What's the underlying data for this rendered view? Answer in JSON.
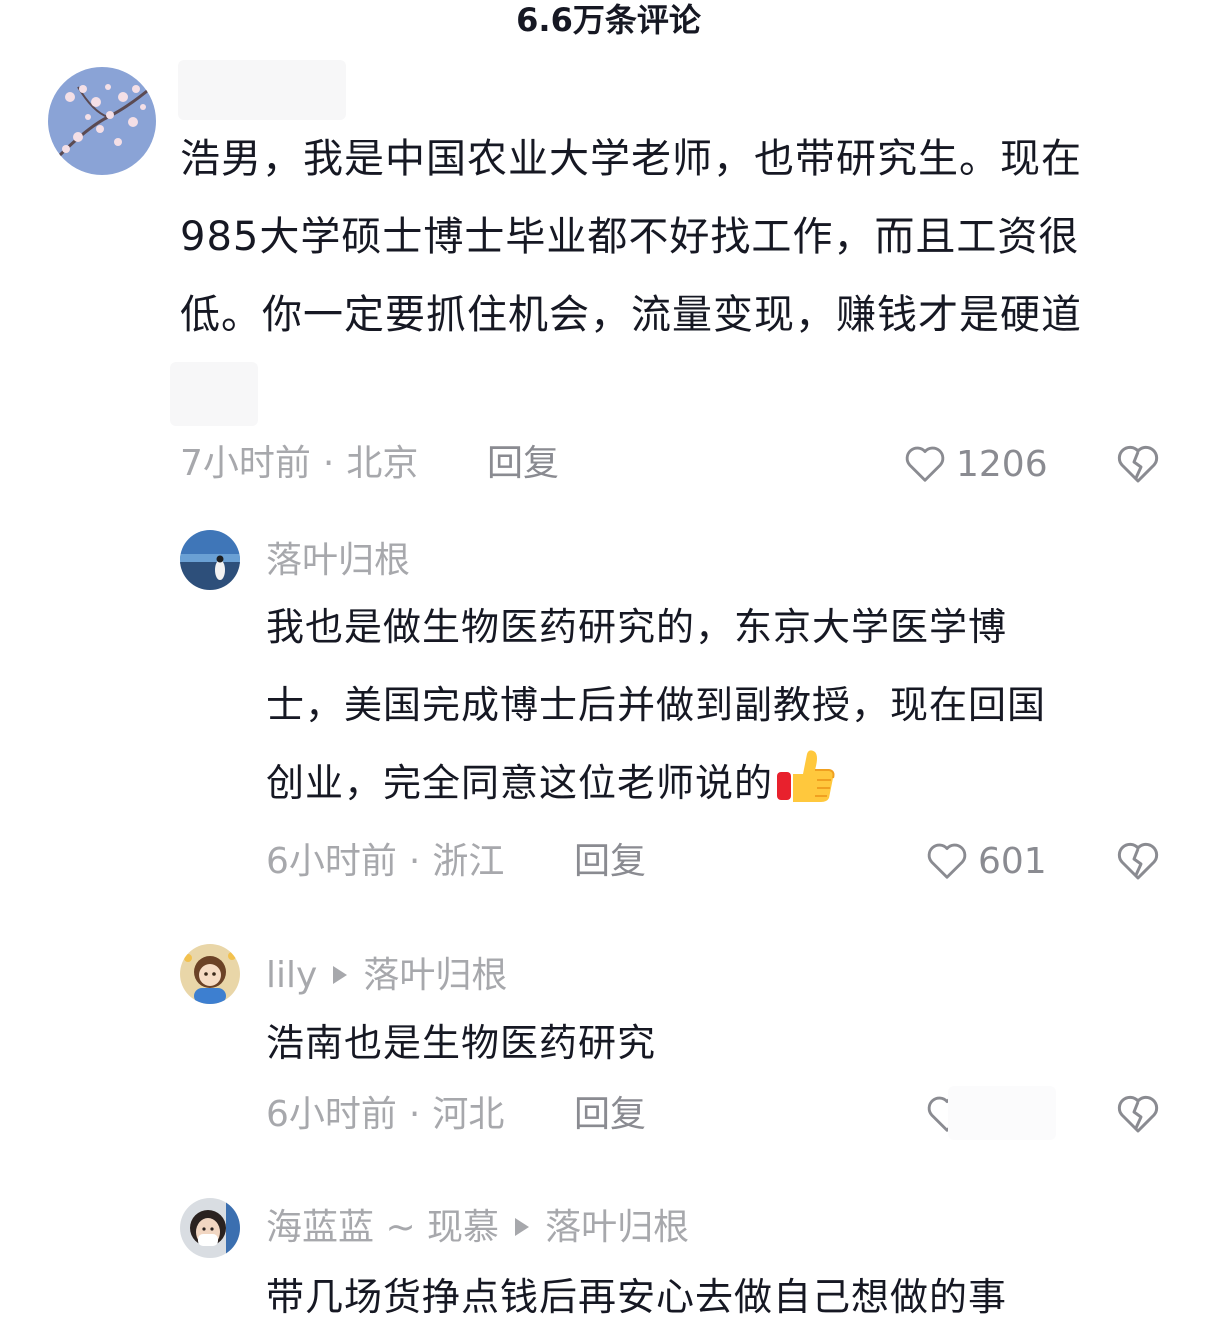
{
  "header": {
    "title": "6.6万条评论"
  },
  "comments": [
    {
      "text_lines": [
        "浩男，我是中国农业大学老师，也带研究生。现在",
        "985大学硕士博士毕业都不好找工作，而且工资很",
        "低。你一定要抓住机会，流量变现，赚钱才是硬道"
      ],
      "time": "7小时前",
      "location": "北京",
      "reply_label": "回复",
      "likes": "1206"
    }
  ],
  "replies": [
    {
      "username": "落叶归根",
      "reply_to": "",
      "text_lines": [
        "我也是做生物医药研究的，东京大学医学博",
        "士，美国完成博士后并做到副教授，现在回国",
        "创业，完全同意这位老师说的"
      ],
      "emoji": "thumbs-up",
      "time": "6小时前",
      "location": "浙江",
      "reply_label": "回复",
      "likes": "601"
    },
    {
      "username": "lily",
      "reply_to": "落叶归根",
      "text_lines": [
        "浩南也是生物医药研究"
      ],
      "time": "6小时前",
      "location": "河北",
      "reply_label": "回复",
      "likes": ""
    },
    {
      "username": "海蓝蓝 ~ 现慕",
      "reply_to": "落叶归根",
      "text_lines": [
        "带几场货挣点钱后再安心去做自己想做的事"
      ]
    }
  ],
  "meta_separator": "·",
  "colors": {
    "text_primary": "#161823",
    "text_secondary": "#a7a8ac",
    "icon_gray": "#8a8b91"
  },
  "icons": {
    "like": "heart-outline-icon",
    "dislike": "broken-heart-icon",
    "reply_arrow": "play-triangle-icon"
  }
}
